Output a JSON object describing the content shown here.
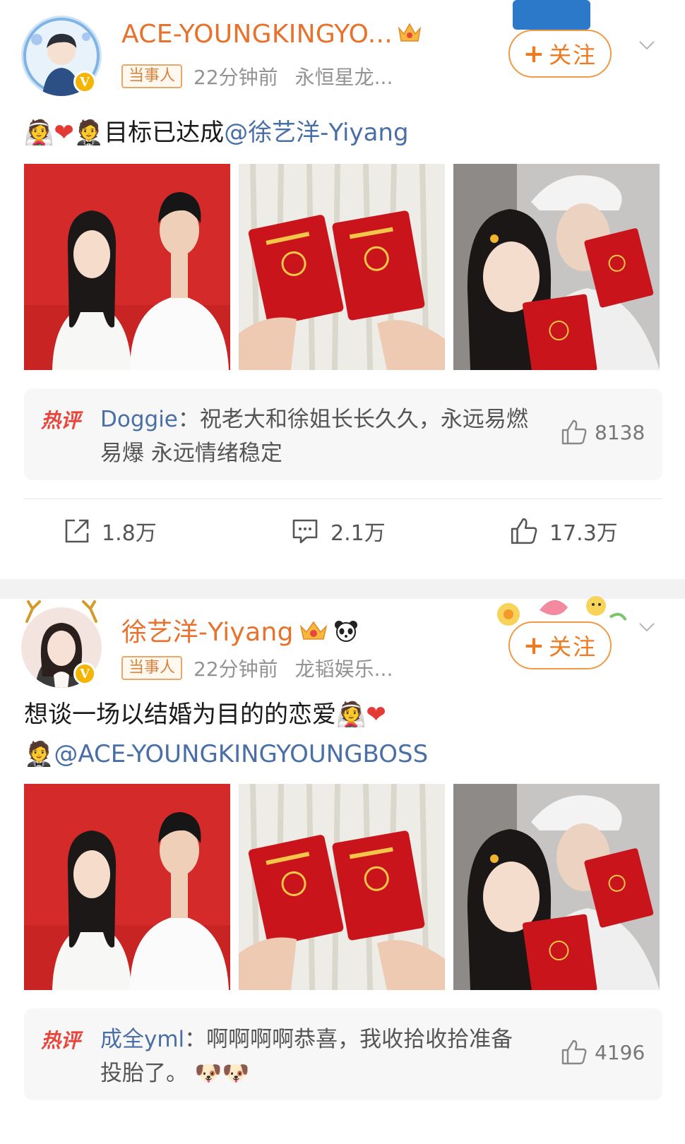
{
  "post1": {
    "username": "ACE-YOUNGKINGYO...",
    "tag": "当事人",
    "time": "22分钟前",
    "source": "永恒星龙...",
    "follow_label": "关注",
    "text_main": "目标已达成",
    "mention": "@徐艺洋-Yiyang",
    "hot_label": "热评",
    "hot_user": "Doggie",
    "hot_text": "：祝老大和徐姐长长久久，永远易燃易爆 永远情绪稳定",
    "hot_likes": "8138",
    "reposts": "1.8万",
    "comments": "2.1万",
    "likes": "17.3万"
  },
  "post2": {
    "username": "徐艺洋-Yiyang",
    "tag": "当事人",
    "time": "22分钟前",
    "source": "龙韬娱乐...",
    "follow_label": "关注",
    "text_main": "想谈一场以结婚为目的的恋爱",
    "mention": "@ACE-YOUNGKINGYOUNGBOSS",
    "hot_label": "热评",
    "hot_user": "成全yml",
    "hot_text": "：啊啊啊啊恭喜，我收拾收拾准备投胎了。",
    "hot_likes": "4196"
  },
  "colors": {
    "username": "#e8712c",
    "link": "#4a6fa6",
    "follow": "#f07a1f",
    "hot_label": "#e8453c"
  }
}
